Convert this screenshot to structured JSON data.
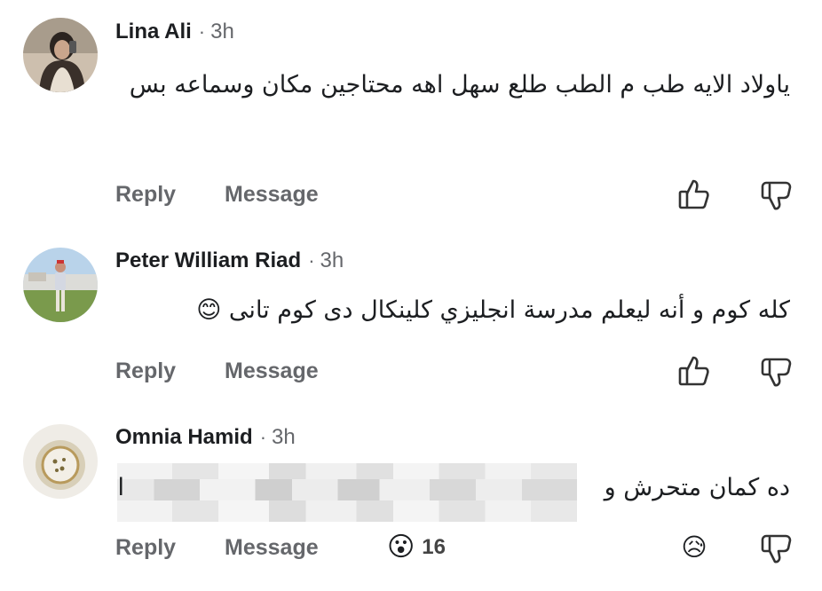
{
  "comments": [
    {
      "name": "Lina Ali",
      "sep": "·",
      "time": "3h",
      "text": "ياولاد الايه طب م الطب طلع سهل اهه محتاجين مكان وسماعه بس",
      "reply_label": "Reply",
      "message_label": "Message"
    },
    {
      "name": "Peter William Riad",
      "sep": "·",
      "time": "3h",
      "text": "كله كوم و أنه ليعلم مدرسة انجليزي كلينكال دى كوم تانى 😊",
      "reply_label": "Reply",
      "message_label": "Message"
    },
    {
      "name": "Omnia Hamid",
      "sep": "·",
      "time": "3h",
      "text": "ده كمان متحرش و",
      "trailing_char": "ا",
      "reply_label": "Reply",
      "message_label": "Message",
      "reaction_emoji": "😮",
      "reaction_count": "16",
      "sad_emoji": "😥"
    }
  ],
  "icons": {
    "like": "thumbs-up-outline",
    "dislike": "thumbs-down-outline"
  },
  "colors": {
    "text": "#1c1e21",
    "muted": "#65676b"
  }
}
